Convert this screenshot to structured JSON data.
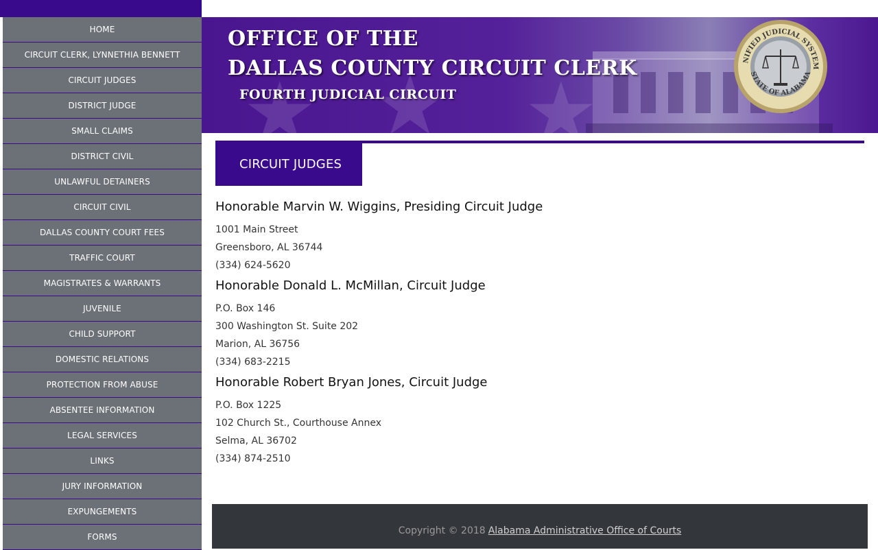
{
  "sidebar": {
    "items": [
      {
        "label": "HOME"
      },
      {
        "label": "CIRCUIT CLERK, LYNNETHIA BENNETT"
      },
      {
        "label": "CIRCUIT JUDGES"
      },
      {
        "label": "DISTRICT JUDGE"
      },
      {
        "label": "SMALL CLAIMS"
      },
      {
        "label": "DISTRICT CIVIL"
      },
      {
        "label": "UNLAWFUL DETAINERS"
      },
      {
        "label": "CIRCUIT CIVIL"
      },
      {
        "label": "DALLAS COUNTY COURT FEES"
      },
      {
        "label": "TRAFFIC COURT"
      },
      {
        "label": "MAGISTRATES & WARRANTS"
      },
      {
        "label": "JUVENILE"
      },
      {
        "label": "CHILD SUPPORT"
      },
      {
        "label": "DOMESTIC RELATIONS"
      },
      {
        "label": "PROTECTION FROM ABUSE"
      },
      {
        "label": "ABSENTEE INFORMATION"
      },
      {
        "label": "LEGAL SERVICES"
      },
      {
        "label": "LINKS"
      },
      {
        "label": "JURY INFORMATION"
      },
      {
        "label": "EXPUNGEMENTS"
      },
      {
        "label": "FORMS"
      }
    ]
  },
  "header": {
    "line1": "OFFICE OF THE",
    "line2": "DALLAS COUNTY CIRCUIT CLERK",
    "line3": "FOURTH JUDICIAL CIRCUIT",
    "seal": {
      "top_text": "UNIFIED JUDICIAL SYSTEM",
      "bottom_text": "STATE OF ALABAMA"
    }
  },
  "main": {
    "section_title": "CIRCUIT JUDGES",
    "judges": [
      {
        "name": "Honorable Marvin W. Wiggins, Presiding Circuit Judge",
        "lines": [
          "1001 Main Street",
          "Greensboro, AL 36744",
          "(334) 624-5620"
        ]
      },
      {
        "name": "Honorable Donald L. McMillan, Circuit Judge",
        "lines": [
          "P.O. Box 146",
          "300 Washington St. Suite 202",
          "Marion, AL 36756",
          "(334) 683-2215"
        ]
      },
      {
        "name": "Honorable Robert Bryan Jones, Circuit Judge",
        "lines": [
          "P.O. Box 1225",
          "102 Church St., Courthouse Annex",
          "Selma, AL 36702",
          "(334) 874-2510"
        ]
      }
    ]
  },
  "footer": {
    "copyright": "Copyright © 2018",
    "link_text": "Alabama Administrative Office of Courts"
  },
  "colors": {
    "brand_purple": "#3a0a8c",
    "nav_gray": "#6b7177",
    "footer_bg": "#33363a"
  }
}
